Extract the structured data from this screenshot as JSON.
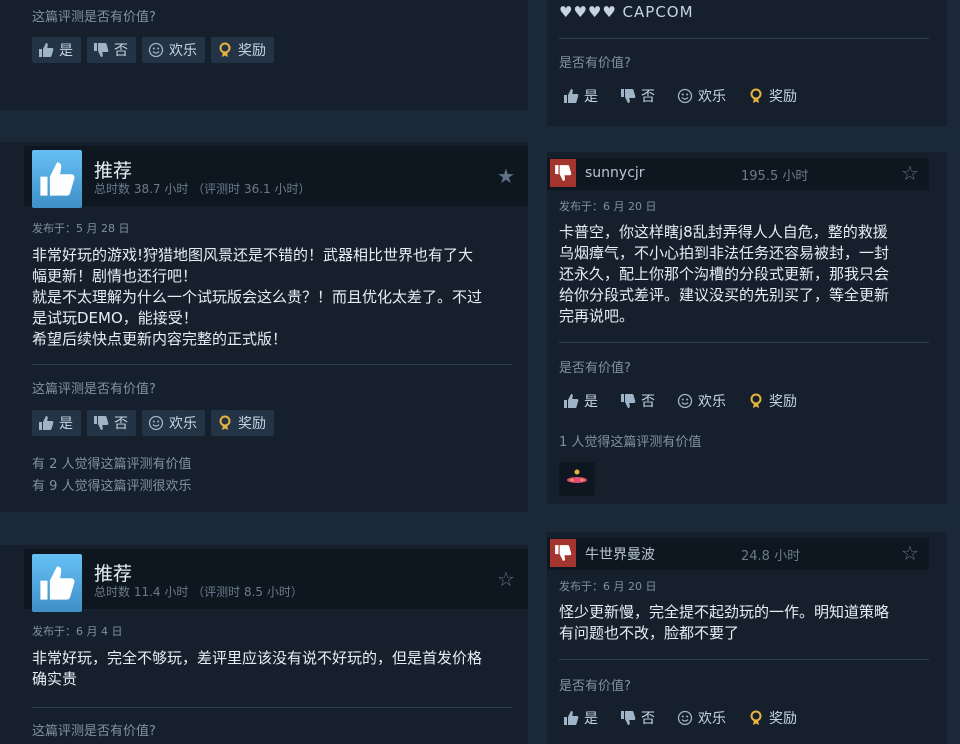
{
  "left_reviews": [
    {
      "helpful_q": "这篇评测是否有价值?"
    },
    {
      "title": "推荐",
      "hours": "总时数 38.7 小时 （评测时 36.1 小时）",
      "posted": "发布于：5 月 28 日",
      "text": [
        "非常好玩的游戏!狩猎地图风景还是不错的！武器相比世界也有了大",
        "幅更新！剧情也还行吧！",
        "就是不太理解为什么一个试玩版会这么贵？！而且优化太差了。不过",
        "是试玩DEMO，能接受！",
        "希望后续快点更新内容完整的正式版！"
      ],
      "helpful_q": "这篇评测是否有价值?",
      "votes": [
        "有 2 人觉得这篇评测有价值",
        "有 9 人觉得这篇评测很欢乐"
      ]
    },
    {
      "title": "推荐",
      "hours": "总时数 11.4 小时 （评测时 8.5 小时）",
      "posted": "发布于：6 月 4 日",
      "text": [
        "非常好玩，完全不够玩，差评里应该没有说不好玩的，但是首发价格",
        "确实贵"
      ],
      "helpful_q": "这篇评测是否有价值?"
    }
  ],
  "buttons": {
    "yes": "是",
    "no": "否",
    "funny": "欢乐",
    "award": "奖励"
  },
  "right_reviews": [
    {
      "developer": "♥♥♥♥ CAPCOM",
      "helpful_q": "是否有价值?"
    },
    {
      "user": "sunnycjr",
      "hours": "195.5 小时",
      "posted": "发布于：6 月 20 日",
      "text": [
        "卡普空，你这样瞎j8乱封弄得人人自危，整的救援",
        "乌烟瘴气，不小心拍到非法任务还容易被封，一封",
        "还永久，配上你那个沟槽的分段式更新，那我只会",
        "给你分段式差评。建议没买的先别买了，等全更新",
        "完再说吧。"
      ],
      "helpful_q": "是否有价值?",
      "votes": "1 人觉得这篇评测有价值"
    },
    {
      "user": "牛世界曼波",
      "hours": "24.8 小时",
      "posted": "发布于：6 月 20 日",
      "text": [
        "怪少更新慢，完全提不起劲玩的一作。明知道策略",
        "有问题也不改，脸都不要了"
      ],
      "helpful_q": "是否有价值?"
    }
  ],
  "colors": {
    "bg": "#1b2838",
    "panel": "#16202d",
    "accent": "#66c0f4",
    "negative": "#a3342e"
  }
}
